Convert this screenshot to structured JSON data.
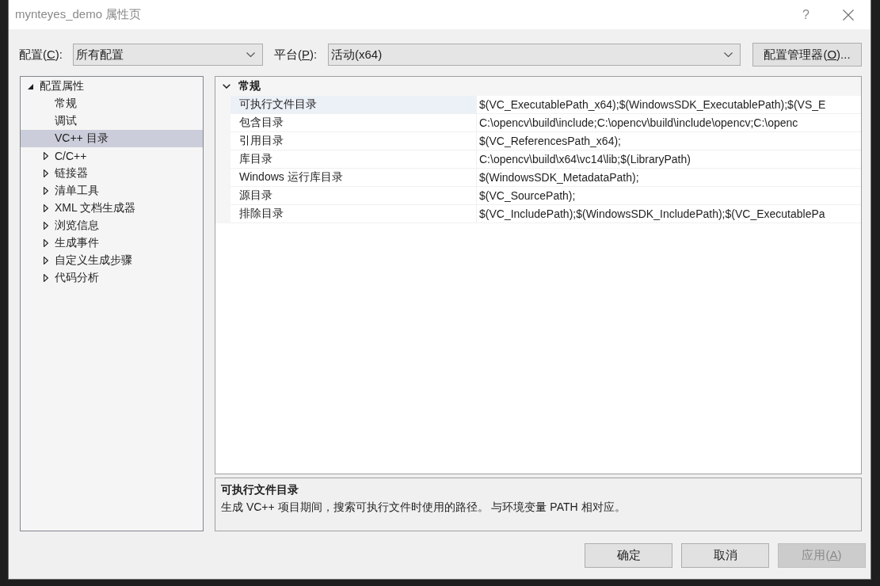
{
  "window": {
    "title": "mynteyes_demo 属性页",
    "help": "?"
  },
  "config_bar": {
    "configuration": {
      "label_before": "配置(",
      "access_key": "C",
      "label_after": "):",
      "value": "所有配置"
    },
    "platform": {
      "label_before": "平台(",
      "access_key": "P",
      "label_after": "):",
      "value": "活动(x64)"
    },
    "manager_button": {
      "label_before": "配置管理器(",
      "access_key": "O",
      "label_after": ")..."
    }
  },
  "tree": [
    {
      "label": "配置属性",
      "kind": "group",
      "expanded": true,
      "selected": false,
      "children": [
        {
          "label": "常规",
          "kind": "page",
          "selected": false
        },
        {
          "label": "调试",
          "kind": "page",
          "selected": false
        },
        {
          "label": "VC++ 目录",
          "kind": "page",
          "selected": true
        },
        {
          "label": "C/C++",
          "kind": "group",
          "expanded": false,
          "selected": false
        },
        {
          "label": "链接器",
          "kind": "group",
          "expanded": false,
          "selected": false
        },
        {
          "label": "清单工具",
          "kind": "group",
          "expanded": false,
          "selected": false
        },
        {
          "label": "XML 文档生成器",
          "kind": "group",
          "expanded": false,
          "selected": false
        },
        {
          "label": "浏览信息",
          "kind": "group",
          "expanded": false,
          "selected": false
        },
        {
          "label": "生成事件",
          "kind": "group",
          "expanded": false,
          "selected": false
        },
        {
          "label": "自定义生成步骤",
          "kind": "group",
          "expanded": false,
          "selected": false
        },
        {
          "label": "代码分析",
          "kind": "group",
          "expanded": false,
          "selected": false
        }
      ]
    }
  ],
  "property_grid": {
    "category": {
      "label": "常规",
      "expanded": true
    },
    "properties": [
      {
        "name": "可执行文件目录",
        "value": "$(VC_ExecutablePath_x64);$(WindowsSDK_ExecutablePath);$(VS_E",
        "selected": true
      },
      {
        "name": "包含目录",
        "value": "C:\\opencv\\build\\include;C:\\opencv\\build\\include\\opencv;C:\\openc",
        "selected": false
      },
      {
        "name": "引用目录",
        "value": "$(VC_ReferencesPath_x64);",
        "selected": false
      },
      {
        "name": "库目录",
        "value": "C:\\opencv\\build\\x64\\vc14\\lib;$(LibraryPath)",
        "selected": false
      },
      {
        "name": "Windows 运行库目录",
        "value": "$(WindowsSDK_MetadataPath);",
        "selected": false
      },
      {
        "name": "源目录",
        "value": "$(VC_SourcePath);",
        "selected": false
      },
      {
        "name": "排除目录",
        "value": "$(VC_IncludePath);$(WindowsSDK_IncludePath);$(VC_ExecutablePa",
        "selected": false
      }
    ]
  },
  "description": {
    "title": "可执行文件目录",
    "text": "生成 VC++ 项目期间，搜索可执行文件时使用的路径。 与环境变量 PATH 相对应。"
  },
  "buttons": [
    {
      "label": "确定",
      "disabled": false
    },
    {
      "label": "取消",
      "disabled": false
    },
    {
      "label_before": "应用(",
      "access_key": "A",
      "label_after": ")",
      "disabled": true
    }
  ]
}
